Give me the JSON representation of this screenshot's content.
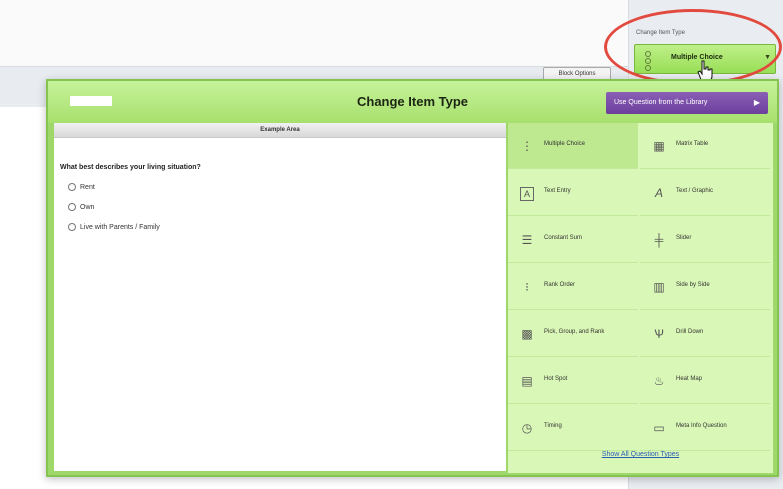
{
  "page": {
    "block_options_label": "Block Options"
  },
  "change_item_type_panel": {
    "label": "Change Item Type",
    "selected_value": "Multiple Choice"
  },
  "modal": {
    "title": "Change Item Type",
    "library_button_label": "Use Question from the Library",
    "example_area_label": "Example Area",
    "question_text": "What best describes your living situation?",
    "options": [
      "Rent",
      "Own",
      "Live with Parents / Family"
    ],
    "question_types": [
      {
        "label": "Multiple Choice",
        "icon": "multiple-choice-icon",
        "selected": true
      },
      {
        "label": "Matrix Table",
        "icon": "matrix-table-icon",
        "selected": false
      },
      {
        "label": "Text Entry",
        "icon": "text-entry-icon",
        "selected": false
      },
      {
        "label": "Text / Graphic",
        "icon": "text-graphic-icon",
        "selected": false
      },
      {
        "label": "Constant Sum",
        "icon": "constant-sum-icon",
        "selected": false
      },
      {
        "label": "Slider",
        "icon": "slider-icon",
        "selected": false
      },
      {
        "label": "Rank Order",
        "icon": "rank-order-icon",
        "selected": false
      },
      {
        "label": "Side by Side",
        "icon": "side-by-side-icon",
        "selected": false
      },
      {
        "label": "Pick, Group, and Rank",
        "icon": "pick-group-rank-icon",
        "selected": false
      },
      {
        "label": "Drill Down",
        "icon": "drill-down-icon",
        "selected": false
      },
      {
        "label": "Hot Spot",
        "icon": "hot-spot-icon",
        "selected": false
      },
      {
        "label": "Heat Map",
        "icon": "heat-map-icon",
        "selected": false
      },
      {
        "label": "Timing",
        "icon": "timing-icon",
        "selected": false
      },
      {
        "label": "Meta Info Question",
        "icon": "meta-info-icon",
        "selected": false
      }
    ],
    "show_all_label": "Show All Question Types"
  },
  "colors": {
    "accent_green": "#9ed86a",
    "library_purple": "#6c3f9c",
    "highlight_red": "#e24a3f"
  }
}
